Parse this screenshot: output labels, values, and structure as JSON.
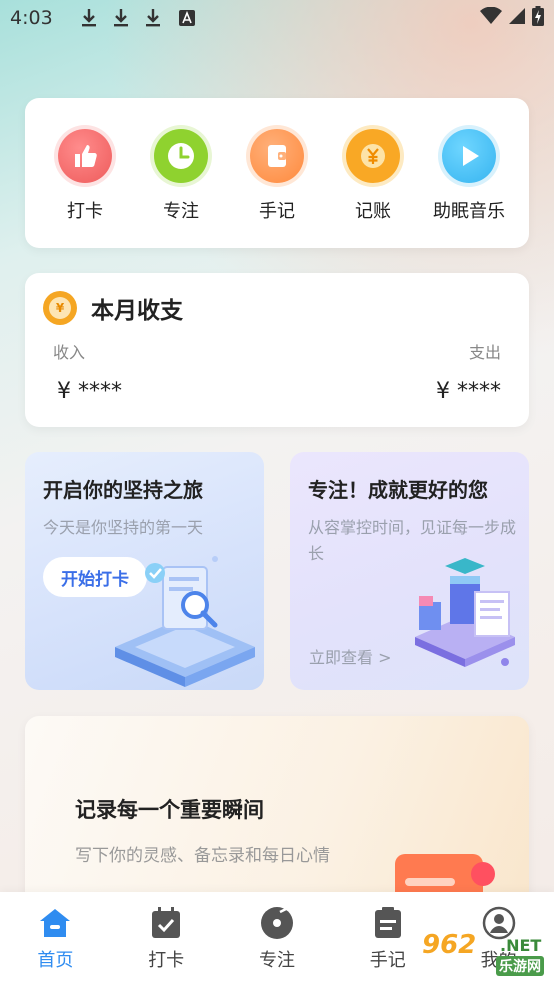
{
  "status_bar": {
    "time": "4:03",
    "download_icons": [
      "download-icon",
      "download-icon",
      "download-icon"
    ],
    "notification_icon": "a-app-icon",
    "right_icons": [
      "wifi-icon",
      "signal-icon",
      "battery-charging-icon"
    ]
  },
  "quick_actions": [
    {
      "label": "打卡",
      "icon": "thumbs-up-icon",
      "color": "#f26b6b"
    },
    {
      "label": "专注",
      "icon": "clock-icon",
      "color": "#8fd22f"
    },
    {
      "label": "手记",
      "icon": "notebook-icon",
      "color": "#ff9a4a"
    },
    {
      "label": "记账",
      "icon": "yen-coin-icon",
      "color": "#f9a825"
    },
    {
      "label": "助眠音乐",
      "icon": "play-icon",
      "color": "#4fc3f7"
    }
  ],
  "balance": {
    "title": "本月收支",
    "income_label": "收入",
    "expense_label": "支出",
    "income_value": "¥ ****",
    "expense_value": "¥ ****",
    "coin_symbol": "¥"
  },
  "checkin_card": {
    "title": "开启你的坚持之旅",
    "desc": "今天是你坚持的第一天",
    "button": "开始打卡"
  },
  "focus_card": {
    "title": "专注！成就更好的您",
    "desc": "从容掌控时间，见证每一步成长",
    "link": "立即查看 >"
  },
  "moments_card": {
    "title": "记录每一个重要瞬间",
    "desc": "写下你的灵感、备忘录和每日心情"
  },
  "bottom_nav": [
    {
      "label": "首页",
      "icon": "home-icon",
      "active": true
    },
    {
      "label": "打卡",
      "icon": "calendar-check-icon",
      "active": false
    },
    {
      "label": "专注",
      "icon": "focus-disc-icon",
      "active": false
    },
    {
      "label": "手记",
      "icon": "note-icon",
      "active": false
    },
    {
      "label": "我的",
      "icon": "profile-icon",
      "active": false
    }
  ],
  "watermark": {
    "num": "962",
    "net": ".NET",
    "site": "乐游网"
  },
  "colors": {
    "accent": "#2f8cf0",
    "checkin_button_text": "#3b6fe8"
  }
}
